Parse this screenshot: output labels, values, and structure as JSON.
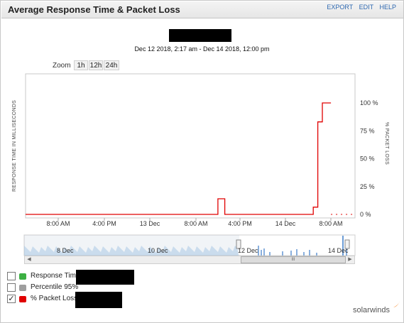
{
  "header": {
    "title": "Average Response Time & Packet Loss",
    "links": [
      "EXPORT",
      "EDIT",
      "HELP"
    ]
  },
  "date_range": "Dec 12 2018, 2:17 am - Dec 14 2018, 12:00 pm",
  "zoom": {
    "label": "Zoom",
    "options": [
      "1h",
      "12h",
      "24h"
    ]
  },
  "legend": [
    {
      "label": "Response Tim",
      "checked": false,
      "color": "#3cb043"
    },
    {
      "label": "Percentile 95%",
      "checked": false,
      "color": "#9e9e9e"
    },
    {
      "label": "% Packet Loss",
      "checked": true,
      "color": "#e00000"
    }
  ],
  "navigator": {
    "labels": [
      "8 Dec",
      "10 Dec",
      "12 Dec",
      "14 Dec"
    ],
    "thumb_grip": "III"
  },
  "brand": "solarwinds",
  "colors": {
    "accent": "#2e68b0",
    "series_line": "#e00000",
    "nav_area": "#9ec3e6",
    "nav_series": "#3c7cc8"
  },
  "chart_data": {
    "type": "line",
    "ylabel_left": "RESPONSE TIME IN MILLISECONDS",
    "ylabel_right": "% PACKET LOSS",
    "xticks": [
      "8:00 AM",
      "4:00 PM",
      "13 Dec",
      "8:00 AM",
      "4:00 PM",
      "14 Dec",
      "8:00 AM"
    ],
    "yticks_right": [
      "100 %",
      "75 %",
      "50 %",
      "25 %",
      "0 %"
    ],
    "ylim_right": [
      0,
      100
    ],
    "x_range_hours": [
      0,
      57.72
    ],
    "series": [
      {
        "name": "% Packet Loss",
        "style": "step",
        "points": [
          [
            0,
            0
          ],
          [
            33.7,
            0
          ],
          [
            33.7,
            14
          ],
          [
            34.9,
            14
          ],
          [
            34.9,
            0
          ],
          [
            50.4,
            0
          ],
          [
            50.4,
            6.5
          ],
          [
            51.2,
            6.5
          ],
          [
            51.2,
            83
          ],
          [
            52.0,
            83
          ],
          [
            52.0,
            100
          ],
          [
            53.5,
            100
          ]
        ]
      }
    ],
    "dashed_baseline": [
      [
        0,
        29.7
      ],
      [
        53.5,
        57.72
      ]
    ],
    "grid": true
  }
}
